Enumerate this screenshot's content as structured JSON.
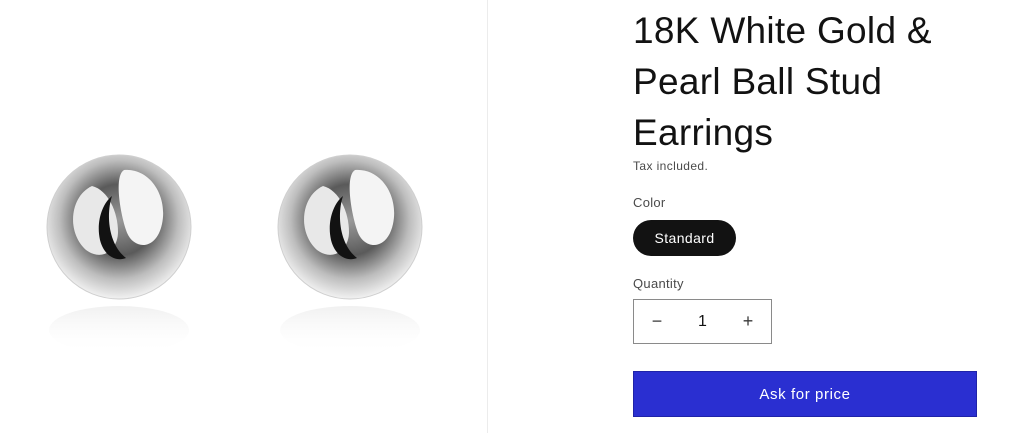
{
  "product": {
    "title": "18K White Gold & Pearl Ball Stud Earrings",
    "tax_note": "Tax included.",
    "image_subject": "earring-pair-photo"
  },
  "options": {
    "color_label": "Color",
    "color_selected": "Standard"
  },
  "quantity": {
    "label": "Quantity",
    "decrease_icon": "minus-icon",
    "increase_icon": "plus-icon",
    "decrease_glyph": "−",
    "increase_glyph": "+",
    "value": "1"
  },
  "cta": {
    "label": "Ask for price",
    "color": "#2a2fd1"
  }
}
